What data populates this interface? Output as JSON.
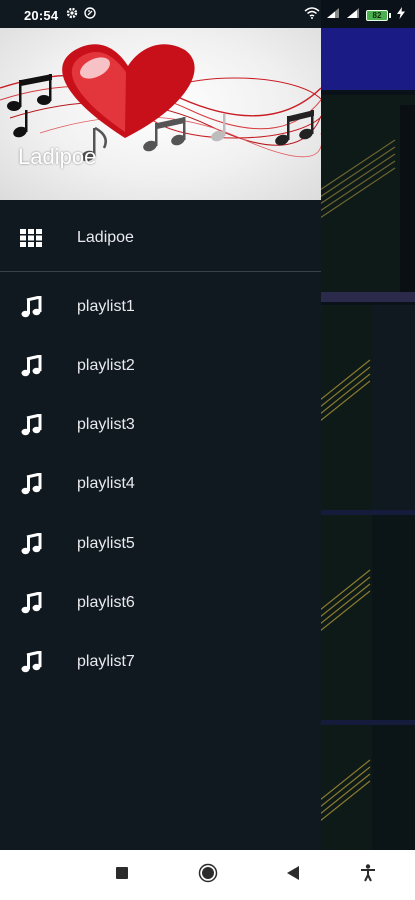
{
  "status_bar": {
    "time": "20:54",
    "battery": "82",
    "icons": [
      "settings-icon",
      "notification-icon",
      "wifi-icon",
      "cellular-signal-icon",
      "cellular-signal-icon",
      "battery-icon",
      "charging-icon"
    ]
  },
  "drawer": {
    "header_title": "Ladipoe",
    "items": [
      {
        "label": "Ladipoe",
        "icon": "grid-icon"
      },
      {
        "label": "playlist1",
        "icon": "music-note-icon"
      },
      {
        "label": "playlist2",
        "icon": "music-note-icon"
      },
      {
        "label": "playlist3",
        "icon": "music-note-icon"
      },
      {
        "label": "playlist4",
        "icon": "music-note-icon"
      },
      {
        "label": "playlist5",
        "icon": "music-note-icon"
      },
      {
        "label": "playlist6",
        "icon": "music-note-icon"
      },
      {
        "label": "playlist7",
        "icon": "music-note-icon"
      }
    ]
  },
  "nav_bar": {
    "buttons": [
      "recents-icon",
      "home-icon",
      "back-icon",
      "accessibility-icon"
    ]
  },
  "colors": {
    "drawer_bg": "#101820",
    "menu_text": "#e8eaee",
    "nav_bar_bg": "#ffffff",
    "battery": "#4caf50",
    "accent_header": "#c8101a"
  }
}
